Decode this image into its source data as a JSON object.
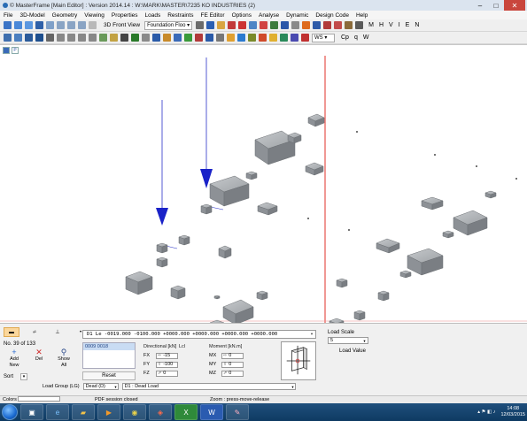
{
  "window": {
    "title": "© MasterFrame [Main Editor] : Version 2014.14 : W:\\MARK\\MASTER\\7235 KO INDUSTRIES (2)",
    "controls": {
      "minimize": "–",
      "maximize": "□",
      "close": "✕"
    }
  },
  "menu": [
    "File",
    "3D-Model",
    "Geometry",
    "Viewing",
    "Properties",
    "Loads",
    "Restraints",
    "FE Editor",
    "Options",
    "Analyse",
    "Dynamic",
    "Design Code",
    "Help"
  ],
  "toolbar1": {
    "view_label": "3D Front View",
    "layer_select": "Foundation Floo",
    "letters": [
      "M",
      "H",
      "V",
      "I",
      "E",
      "N"
    ]
  },
  "toolbar2": {
    "case_select": "WS",
    "letters": [
      "Cp",
      "q",
      "W"
    ]
  },
  "doc_tabs": [
    "",
    "P"
  ],
  "viewport": {
    "red_line_color": "#e0302a",
    "block_color": "#9aa0a6",
    "support_color": "#1a22c8"
  },
  "panel": {
    "tool_icons": [
      "beam-load-icon",
      "truss-load-icon",
      "support-icon",
      "pin-icon"
    ],
    "record_count": "No. 39 of 133",
    "add_label": "Add\nNew",
    "del_label": "Del",
    "show_all_label": "Show\nAll",
    "sort_label": "Sort",
    "command": "D1 Le -0019.000 -0100.000 +0000.000 +0000.000 +0000.000 +0000.000",
    "list_item": "0009 0018",
    "reset_label": "Reset",
    "directional_header": "Directional [kN]",
    "loc_header": "Lcl",
    "moment_header": "Moment [kN.m]",
    "forces": [
      {
        "label": "FX",
        "arrow": "⇨",
        "value": "-15"
      },
      {
        "label": "FY",
        "arrow": "⇧",
        "value": "-100"
      },
      {
        "label": "FZ",
        "arrow": "⇗",
        "value": "0"
      }
    ],
    "moments": [
      {
        "label": "MX",
        "arrow": "⇨",
        "value": "0"
      },
      {
        "label": "MY",
        "arrow": "⇧",
        "value": "0"
      },
      {
        "label": "MZ",
        "arrow": "⇗",
        "value": "0"
      }
    ],
    "load_scale_label": "Load Scale",
    "load_scale_value": "5",
    "load_value_label": "Load Value",
    "load_group_label": "Load Group (LG)",
    "load_group_value": "Dead (D)",
    "load_case_value": "D1 : Dead Load"
  },
  "status": {
    "colors_label": "Colors",
    "pdf": "PDF session closed",
    "zoom": "Zoom : press-move-release"
  },
  "taskbar": {
    "apps": [
      "explorer-icon",
      "ie-icon",
      "folder-icon",
      "media-icon",
      "chrome-icon",
      "masterframe-icon",
      "excel-icon",
      "word-icon",
      "paint-icon"
    ],
    "time": "14:08",
    "date": "12/03/2015"
  }
}
